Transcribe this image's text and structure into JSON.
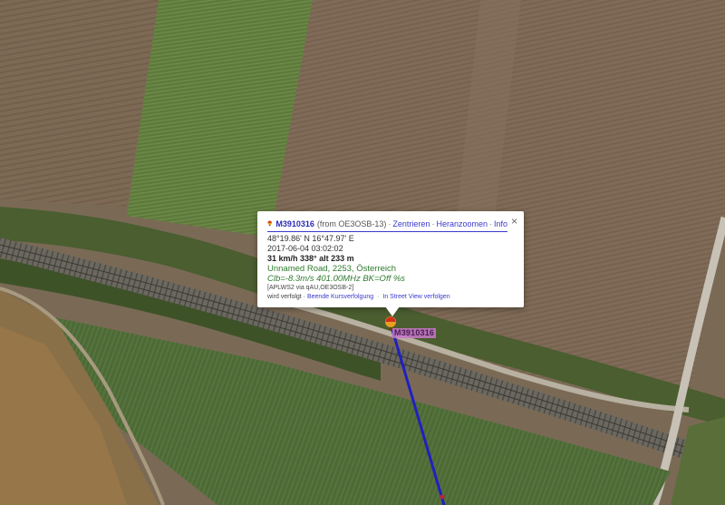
{
  "popup": {
    "callsign": "M3910316",
    "from_text": "(from OE3OSB-13)",
    "links": [
      "Zentrieren",
      "Heranzoomen",
      "Info"
    ],
    "coords": "48°19.86' N 16°47.97' E",
    "timestamp": "2017-06-04 03:02:02",
    "speed_course_alt": "31 km/h 338° alt 233 m",
    "address": "Unnamed Road, 2253, Österreich",
    "comment": "Clb=-8.3m/s 401.00MHz BK=Off %s",
    "path": "[APLWS2 via qAU,OE3OSB-2]",
    "status_prefix": "wird verfolgt ·",
    "action_stop": "Beende Kursverfolgung",
    "action_street": "In Street View verfolgen",
    "close_glyph": "×"
  },
  "marker": {
    "label": "M3910316",
    "icon": "balloon-icon"
  },
  "track": {
    "color": "#2020c0"
  }
}
